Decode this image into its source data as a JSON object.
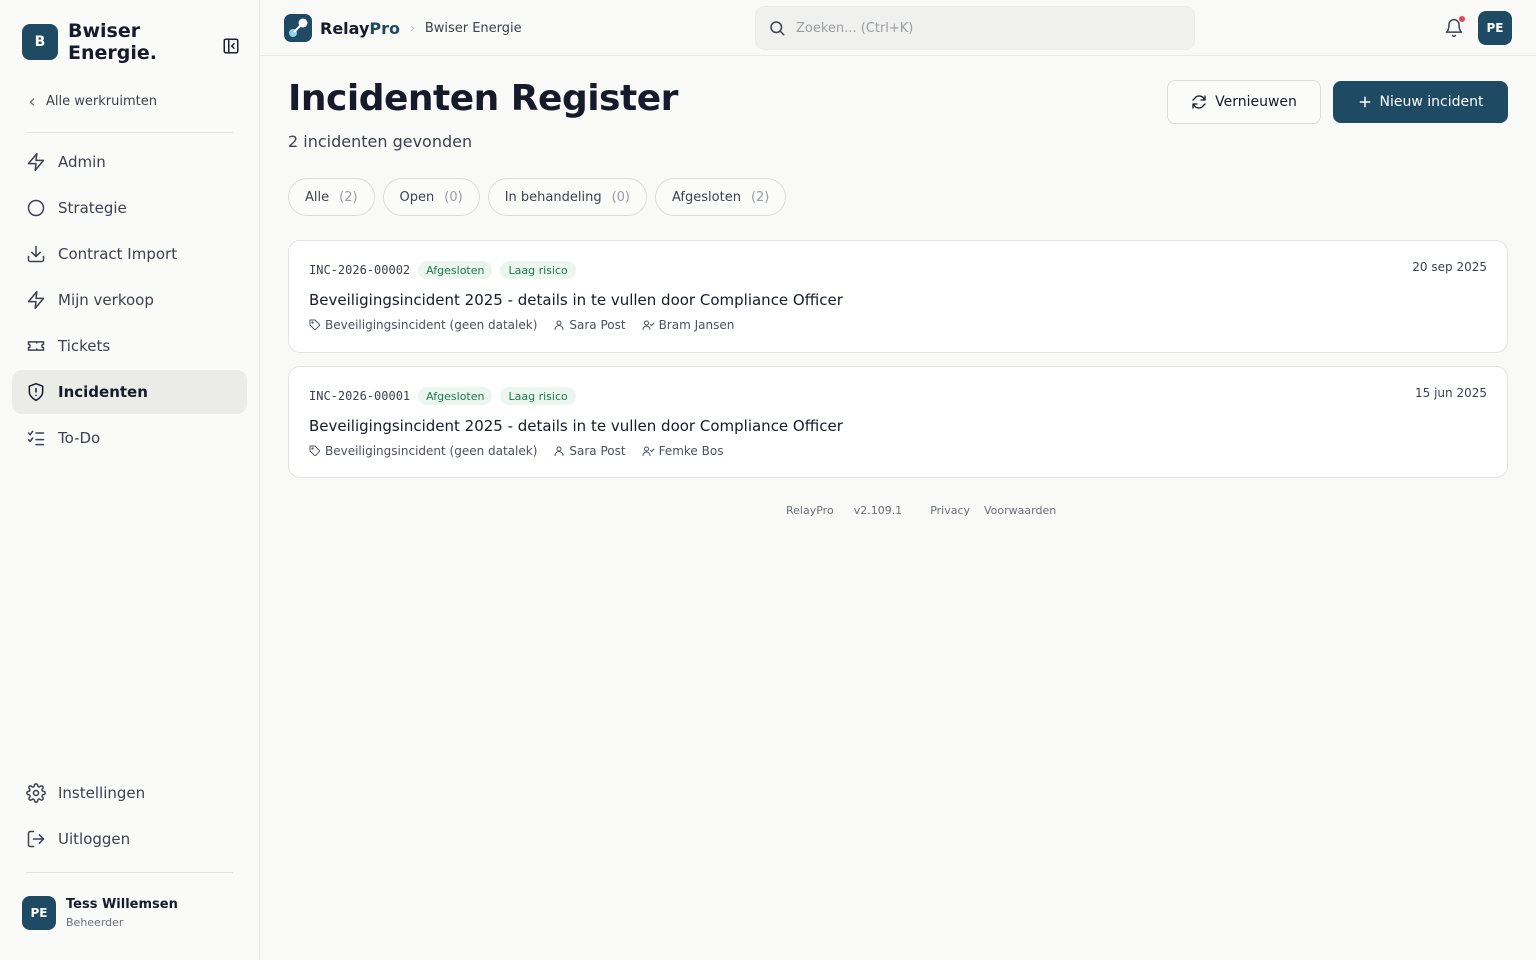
{
  "sidebar": {
    "brand_badge": "B",
    "brand_name": "Bwiser Energie.",
    "back_link": "Alle werkruimten",
    "items": [
      {
        "label": "Admin"
      },
      {
        "label": "Strategie"
      },
      {
        "label": "Contract Import"
      },
      {
        "label": "Mijn verkoop"
      },
      {
        "label": "Tickets"
      },
      {
        "label": "Incidenten"
      },
      {
        "label": "To-Do"
      }
    ],
    "bottom_items": [
      {
        "label": "Instellingen"
      },
      {
        "label": "Uitloggen"
      }
    ],
    "user": {
      "initials": "PE",
      "name": "Tess Willemsen",
      "role": "Beheerder"
    }
  },
  "topbar": {
    "logo_relay": "Relay",
    "logo_pro": "Pro",
    "breadcrumb": "Bwiser Energie",
    "search_placeholder": "Zoeken... (Ctrl+K)",
    "avatar": "PE"
  },
  "page": {
    "title": "Incidenten Register",
    "subtitle": "2 incidenten gevonden",
    "refresh_label": "Vernieuwen",
    "new_label": "Nieuw incident"
  },
  "filters": [
    {
      "label": "Alle",
      "count": "(2)"
    },
    {
      "label": "Open",
      "count": "(0)"
    },
    {
      "label": "In behandeling",
      "count": "(0)"
    },
    {
      "label": "Afgesloten",
      "count": "(2)"
    }
  ],
  "incidents": [
    {
      "id": "INC-2026-00002",
      "status": "Afgesloten",
      "risk": "Laag risico",
      "date": "20 sep 2025",
      "title": "Beveiligingsincident 2025 - details in te vullen door Compliance Officer",
      "category": "Beveiligingsincident (geen datalek)",
      "reporter": "Sara Post",
      "assignee": "Bram Jansen"
    },
    {
      "id": "INC-2026-00001",
      "status": "Afgesloten",
      "risk": "Laag risico",
      "date": "15 jun 2025",
      "title": "Beveiligingsincident 2025 - details in te vullen door Compliance Officer",
      "category": "Beveiligingsincident (geen datalek)",
      "reporter": "Sara Post",
      "assignee": "Femke Bos"
    }
  ],
  "footer": {
    "product": "RelayPro",
    "version": "v2.109.1",
    "privacy": "Privacy",
    "terms": "Voorwaarden"
  }
}
